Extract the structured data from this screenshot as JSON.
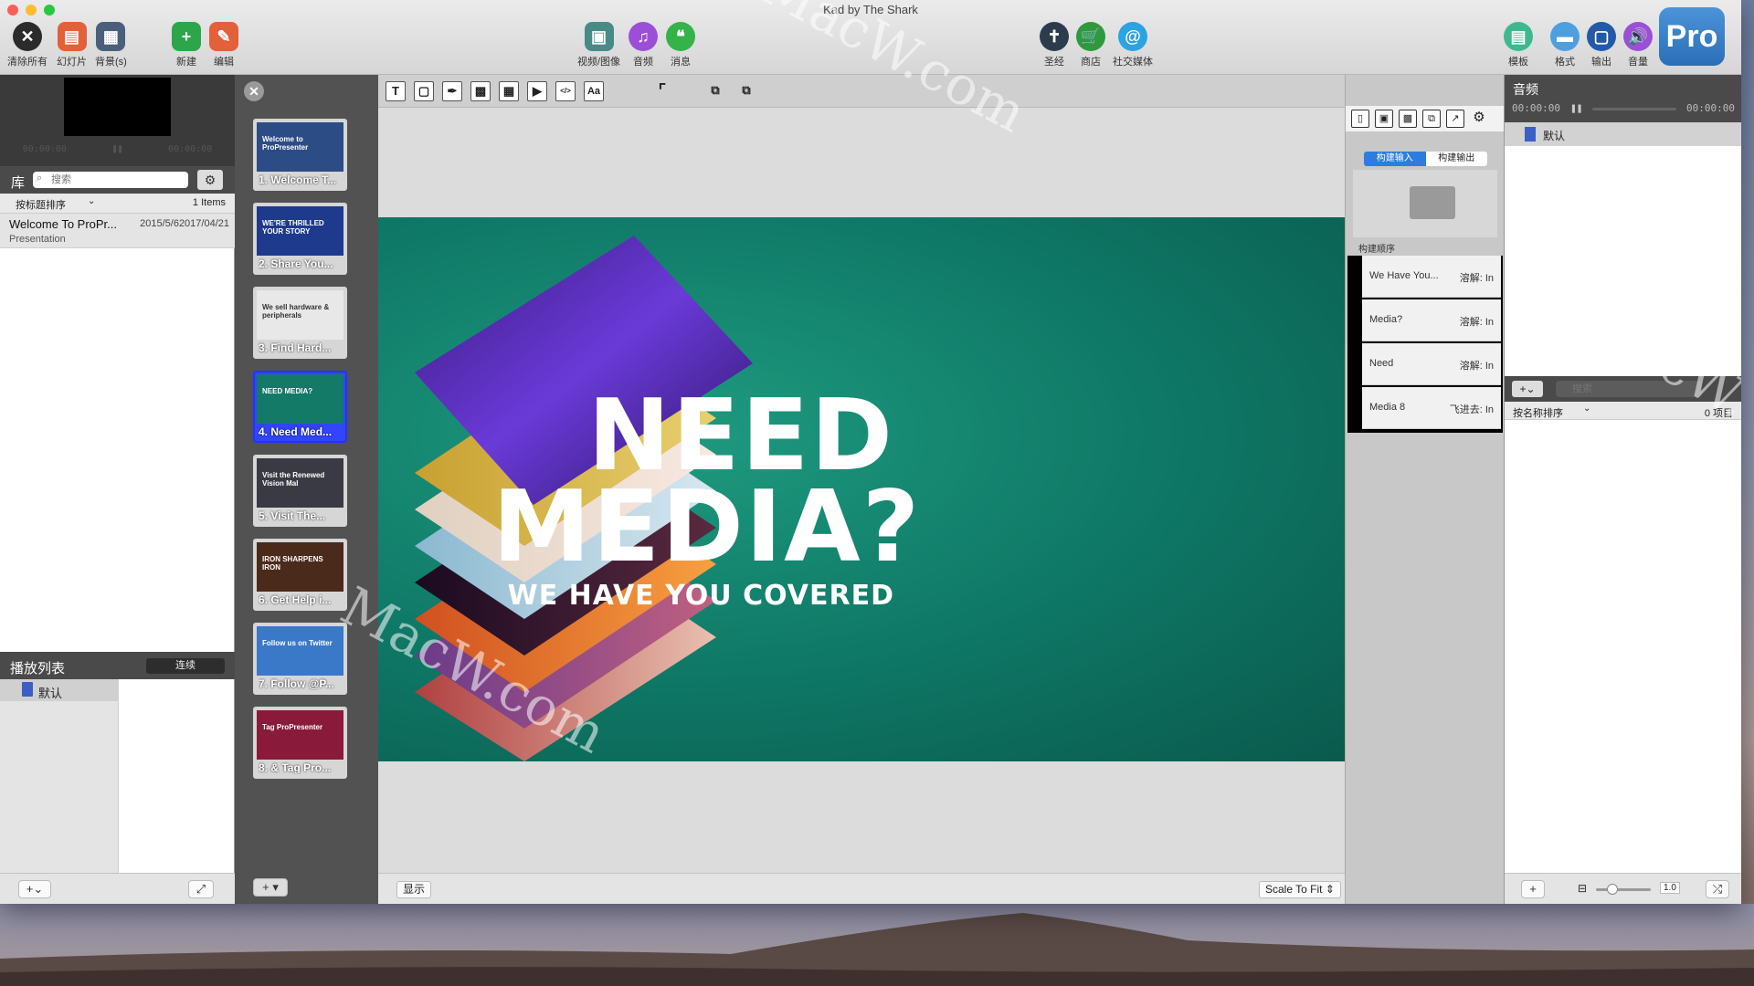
{
  "window": {
    "title": "Kad by The Shark"
  },
  "toolbar": {
    "left": [
      {
        "label": "清除所有",
        "icon": "clear-all-icon",
        "color": "#2b2b2b"
      },
      {
        "label": "幻灯片",
        "icon": "clear-slide-icon",
        "color": "#e2603a"
      },
      {
        "label": "背景(s)",
        "icon": "clear-background-icon",
        "color": "#4b5f7a"
      },
      {
        "label": "新建",
        "icon": "new-icon",
        "color": "#2da54a"
      },
      {
        "label": "编辑",
        "icon": "edit-icon",
        "color": "#e2603a"
      }
    ],
    "center": [
      {
        "label": "视频/图像",
        "icon": "media-icon",
        "color": "#4a8a86"
      },
      {
        "label": "音频",
        "icon": "audio-icon",
        "color": "#9b4fd6"
      },
      {
        "label": "消息",
        "icon": "messages-icon",
        "color": "#35b24a"
      }
    ],
    "right": [
      {
        "label": "圣经",
        "icon": "bible-icon",
        "color": "#2d3c4c"
      },
      {
        "label": "商店",
        "icon": "store-icon",
        "color": "#2d9a3c"
      },
      {
        "label": "社交媒体",
        "icon": "social-icon",
        "color": "#2ba3e0"
      }
    ],
    "far": [
      {
        "label": "模板",
        "icon": "templates-icon",
        "color": "#3fb890"
      },
      {
        "label": "格式",
        "icon": "format-icon",
        "color": "#4f9fe0"
      },
      {
        "label": "输出",
        "icon": "output-icon",
        "color": "#2259a8"
      },
      {
        "label": "音量",
        "icon": "volume-icon",
        "color": "#9b4fd6"
      }
    ],
    "pro_badge": "Pro"
  },
  "preview": {
    "time_start": "00:00:00",
    "time_end": "00:00:00"
  },
  "library": {
    "title": "库",
    "search_placeholder": "搜索",
    "sort_label": "按标题排序",
    "count": "1 Items",
    "item": {
      "title": "Welcome To ProPr...",
      "date": "2015/5/62017/04/21",
      "type": "Presentation"
    }
  },
  "playlist": {
    "title": "播放列表",
    "button": "连续",
    "item": "默认"
  },
  "thumbnails": [
    {
      "label": "1. Welcome T...",
      "text": "Welcome to ProPresenter",
      "color": "#2c4c86"
    },
    {
      "label": "2. Share You...",
      "text": "WE'RE THRILLED YOUR STORY",
      "color": "#1e3a8c"
    },
    {
      "label": "3. Find Hard...",
      "text": "We sell hardware & peripherals",
      "color": "#e8e8e8"
    },
    {
      "label": "4. Need Med...",
      "text": "NEED MEDIA?",
      "color": "#127a67"
    },
    {
      "label": "5. Visit The...",
      "text": "Visit the Renewed Vision Mal",
      "color": "#3a3a44"
    },
    {
      "label": "6. Get Help i...",
      "text": "IRON SHARPENS IRON",
      "color": "#4a2a1a"
    },
    {
      "label": "7. Follow @P...",
      "text": "Follow us on Twitter",
      "color": "#3a78c8"
    },
    {
      "label": "8. & Tag Pro...",
      "text": "Tag ProPresenter",
      "color": "#8a1a3a"
    }
  ],
  "slide": {
    "line1": "NEED",
    "line2": "MEDIA?",
    "line3": "WE HAVE YOU COVERED"
  },
  "canvas": {
    "show_button": "显示",
    "scale": "Scale To Fit"
  },
  "build": {
    "tab_in": "构建输入",
    "tab_out": "构建输出",
    "order_label": "构建顺序",
    "items": [
      {
        "name": "We Have You...",
        "effect": "溶解: In"
      },
      {
        "name": "Media?",
        "effect": "溶解: In"
      },
      {
        "name": "Need",
        "effect": "溶解: In"
      },
      {
        "name": "Media 8",
        "effect": "飞进去: In"
      }
    ]
  },
  "audio": {
    "title": "音频",
    "time_start": "00:00:00",
    "time_end": "00:00:00",
    "list_item": "默认",
    "search_placeholder": "搜索",
    "sort_label": "按名称排序",
    "count": "0 项目",
    "speed": "1.0"
  },
  "watermark": "MacW.com"
}
